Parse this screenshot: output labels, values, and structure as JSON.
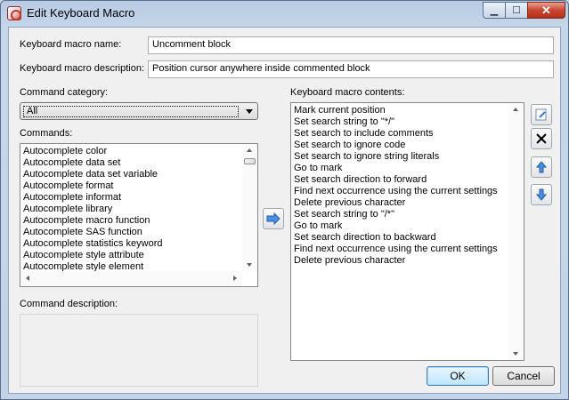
{
  "window": {
    "title": "Edit Keyboard Macro",
    "buttons": {
      "minimize": "▁",
      "maximize": "☐",
      "close": "✕"
    }
  },
  "form": {
    "name_label": "Keyboard macro name:",
    "name_value": "Uncomment block",
    "description_label": "Keyboard macro description:",
    "description_value": "Position cursor anywhere inside commented block"
  },
  "category": {
    "label": "Command category:",
    "selected": "All"
  },
  "commands": {
    "label": "Commands:",
    "items": [
      "Autocomplete color",
      "Autocomplete data set",
      "Autocomplete data set variable",
      "Autocomplete format",
      "Autocomplete informat",
      "Autocomplete library",
      "Autocomplete macro function",
      "Autocomplete SAS function",
      "Autocomplete statistics keyword",
      "Autocomplete style attribute",
      "Autocomplete style element"
    ]
  },
  "command_description": {
    "label": "Command description:"
  },
  "macro_contents": {
    "label": "Keyboard macro contents:",
    "items": [
      "Mark current position",
      "Set search string to \"*/\"",
      "Set search to include comments",
      "Set search to ignore code",
      "Set search to ignore string literals",
      "Go to mark",
      "Set search direction to forward",
      "Find next occurrence using the current settings",
      "Delete previous character",
      "Set search string to \"/*\"",
      "Go to mark",
      "Set search direction to backward",
      "Find next occurrence using the current settings",
      "Delete previous character"
    ]
  },
  "icons": {
    "add": "arrow-right-icon",
    "edit": "edit-icon",
    "delete": "delete-icon",
    "move_up": "arrow-up-icon",
    "move_down": "arrow-down-icon"
  },
  "buttons": {
    "ok": "OK",
    "cancel": "Cancel"
  },
  "colors": {
    "accent_blue": "#2f7bd6",
    "title_bar": "#b8cbe3"
  }
}
